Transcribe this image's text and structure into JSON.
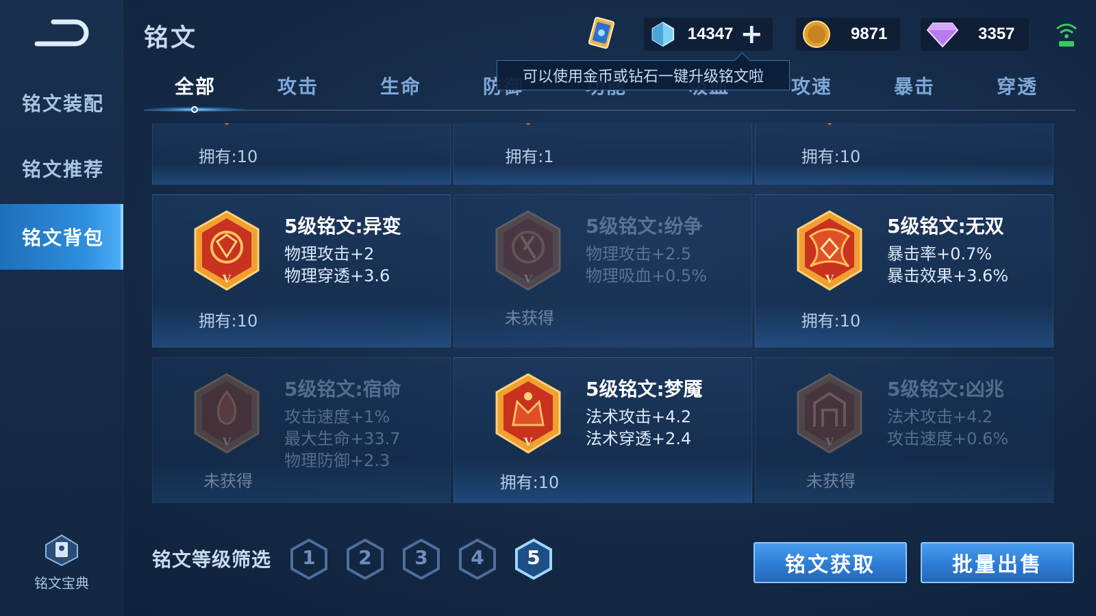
{
  "header": {
    "title": "铭文"
  },
  "sidebar": {
    "items": [
      {
        "label": "铭文装配"
      },
      {
        "label": "铭文推荐"
      },
      {
        "label": "铭文背包"
      }
    ],
    "codex_label": "铭文宝典"
  },
  "currency": {
    "gems": "14347",
    "gold": "9871",
    "diamonds": "3357",
    "plus": "+"
  },
  "tooltip": "可以使用金币或钻石一键升级铭文啦",
  "tabs": [
    {
      "label": "全部"
    },
    {
      "label": "攻击"
    },
    {
      "label": "生命"
    },
    {
      "label": "防御"
    },
    {
      "label": "功能"
    },
    {
      "label": "吸血"
    },
    {
      "label": "攻速"
    },
    {
      "label": "暴击"
    },
    {
      "label": "穿透"
    }
  ],
  "top_row": [
    {
      "owned": "拥有:10"
    },
    {
      "owned": "拥有:1"
    },
    {
      "owned": "拥有:10"
    }
  ],
  "runes": [
    {
      "name": "5级铭文:异变",
      "attrs": [
        "物理攻击+2",
        "物理穿透+3.6"
      ],
      "owned": "拥有:10",
      "acquired": true
    },
    {
      "name": "5级铭文:纷争",
      "attrs": [
        "物理攻击+2.5",
        "物理吸血+0.5%"
      ],
      "owned": "未获得",
      "acquired": false
    },
    {
      "name": "5级铭文:无双",
      "attrs": [
        "暴击率+0.7%",
        "暴击效果+3.6%"
      ],
      "owned": "拥有:10",
      "acquired": true
    },
    {
      "name": "5级铭文:宿命",
      "attrs": [
        "攻击速度+1%",
        "最大生命+33.7",
        "物理防御+2.3"
      ],
      "owned": "未获得",
      "acquired": false
    },
    {
      "name": "5级铭文:梦魇",
      "attrs": [
        "法术攻击+4.2",
        "法术穿透+2.4"
      ],
      "owned": "拥有:10",
      "acquired": true
    },
    {
      "name": "5级铭文:凶兆",
      "attrs": [
        "法术攻击+4.2",
        "攻击速度+0.6%"
      ],
      "owned": "未获得",
      "acquired": false
    }
  ],
  "gem_mark": "V",
  "filter": {
    "label": "铭文等级筛选",
    "levels": [
      "1",
      "2",
      "3",
      "4",
      "5"
    ],
    "selected": "5"
  },
  "buttons": {
    "obtain": "铭文获取",
    "sell": "批量出售"
  },
  "colors": {
    "accent": "#2f8fe0",
    "rune_red": "#c8321e",
    "rune_gold": "#f0a030"
  }
}
